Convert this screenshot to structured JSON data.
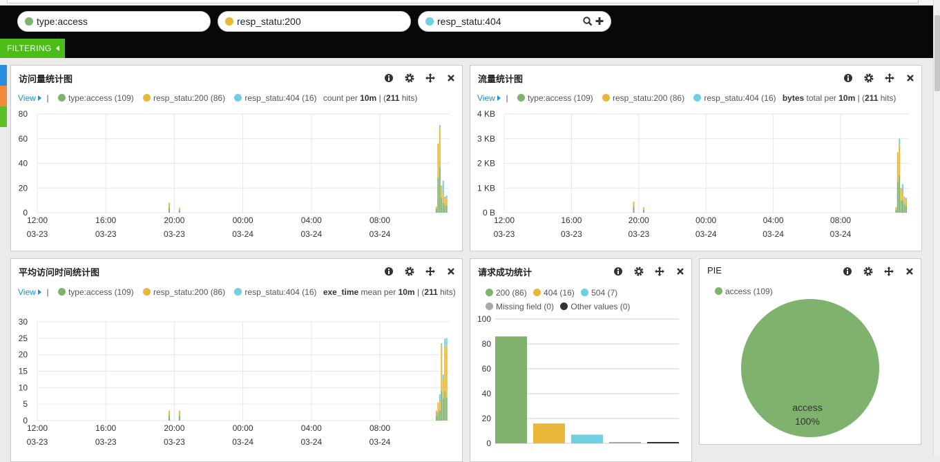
{
  "queries": [
    {
      "text": "type:access",
      "color": "#7eb26d"
    },
    {
      "text": "resp_statu:200",
      "color": "#eab839"
    },
    {
      "text": "resp_statu:404",
      "color": "#6ed0e0"
    }
  ],
  "filtering_label": "FILTERING",
  "colors": {
    "access": "#7eb26d",
    "s200": "#eab839",
    "s404": "#6ed0e0",
    "missing": "#aaaaaa",
    "other": "#333333"
  },
  "panels": {
    "visits": {
      "title": "访问量统计图",
      "legend": {
        "view": "View",
        "items": [
          "type:access (109)",
          "resp_statu:200 (86)",
          "resp_statu:404 (16)"
        ],
        "suffix_pre": "count per ",
        "interval": "10m",
        "suffix_mid": " | (",
        "hits": "211",
        "suffix_post": " hits)"
      }
    },
    "traffic": {
      "title": "流量统计图",
      "legend": {
        "view": "View",
        "items": [
          "type:access (109)",
          "resp_statu:200 (86)",
          "resp_statu:404 (16)"
        ],
        "field": "bytes",
        "suffix_pre": " total per ",
        "interval": "10m",
        "suffix_mid": " | (",
        "hits": "211",
        "suffix_post": " hits)"
      }
    },
    "avgtime": {
      "title": "平均访问时间统计图",
      "legend": {
        "view": "View",
        "items": [
          "type:access (109)",
          "resp_statu:200 (86)",
          "resp_statu:404 (16)"
        ],
        "field": "exe_time",
        "suffix_pre": " mean per ",
        "interval": "10m",
        "suffix_mid": " | (",
        "hits": "211",
        "suffix_post": " hits)"
      }
    },
    "success": {
      "title": "请求成功统计",
      "legend": [
        "200 (86)",
        "404 (16)",
        "504 (7)",
        "Missing field (0)",
        "Other values (0)"
      ]
    },
    "pie": {
      "title": "PIE",
      "legend": [
        "access (109)"
      ],
      "slice_label": "access",
      "slice_pct": "100%"
    }
  },
  "chart_data": [
    {
      "type": "bar",
      "title": "访问量统计图",
      "stacked": true,
      "x_tick_labels": [
        [
          "12:00",
          "03-23"
        ],
        [
          "16:00",
          "03-23"
        ],
        [
          "20:00",
          "03-23"
        ],
        [
          "00:00",
          "03-24"
        ],
        [
          "04:00",
          "03-24"
        ],
        [
          "08:00",
          "03-24"
        ]
      ],
      "y_ticks": [
        "0",
        "20",
        "40",
        "60",
        "80"
      ],
      "ylim": [
        0,
        80
      ],
      "x_hours": [
        19.7,
        20.3,
        11.3,
        11.4,
        11.5,
        11.6,
        11.7,
        11.8,
        11.9
      ],
      "series": [
        {
          "name": "type:access",
          "values": [
            4,
            2,
            3,
            28,
            37,
            12,
            8,
            6,
            6
          ]
        },
        {
          "name": "resp_statu:200",
          "values": [
            4,
            2,
            2,
            28,
            32,
            10,
            7,
            5,
            6
          ]
        },
        {
          "name": "resp_statu:404",
          "values": [
            0,
            0,
            0,
            0,
            2,
            0,
            11,
            2,
            2
          ]
        }
      ]
    },
    {
      "type": "bar",
      "title": "流量统计图",
      "stacked": true,
      "x_tick_labels": [
        [
          "12:00",
          "03-23"
        ],
        [
          "16:00",
          "03-23"
        ],
        [
          "20:00",
          "03-23"
        ],
        [
          "00:00",
          "03-24"
        ],
        [
          "04:00",
          "03-24"
        ],
        [
          "08:00",
          "03-24"
        ]
      ],
      "y_ticks": [
        "0 B",
        "1 KB",
        "2 KB",
        "3 KB",
        "4 KB"
      ],
      "ylim": [
        0,
        4
      ],
      "x_hours": [
        19.7,
        20.3,
        11.3,
        11.4,
        11.5,
        11.6,
        11.7,
        11.8,
        11.9
      ],
      "series": [
        {
          "name": "type:access",
          "values": [
            0.25,
            0.12,
            0.12,
            1.25,
            1.5,
            0.5,
            0.5,
            0.35,
            0.3
          ]
        },
        {
          "name": "resp_statu:200",
          "values": [
            0.2,
            0.1,
            0.1,
            1.2,
            1.25,
            0.5,
            0.35,
            0.25,
            0.2
          ]
        },
        {
          "name": "resp_statu:404",
          "values": [
            0,
            0,
            0,
            0,
            0.25,
            0,
            0.3,
            0.05,
            0.1
          ]
        }
      ]
    },
    {
      "type": "bar",
      "title": "平均访问时间统计图",
      "stacked": true,
      "x_tick_labels": [
        [
          "12:00",
          "03-23"
        ],
        [
          "16:00",
          "03-23"
        ],
        [
          "20:00",
          "03-23"
        ],
        [
          "00:00",
          "03-24"
        ],
        [
          "04:00",
          "03-24"
        ],
        [
          "08:00",
          "03-24"
        ]
      ],
      "y_ticks": [
        "0",
        "5",
        "10",
        "15",
        "20",
        "25",
        "30"
      ],
      "ylim": [
        0,
        30
      ],
      "x_hours": [
        19.7,
        20.3,
        11.3,
        11.4,
        11.5,
        11.6,
        11.7,
        11.8,
        11.9
      ],
      "series": [
        {
          "name": "type:access",
          "values": [
            1.5,
            1.5,
            1.5,
            2.5,
            3,
            9,
            6.5,
            9,
            7
          ]
        },
        {
          "name": "resp_statu:200",
          "values": [
            1.5,
            1.5,
            1.5,
            3,
            3,
            14,
            6,
            13,
            16
          ]
        },
        {
          "name": "resp_statu:404",
          "values": [
            0,
            0,
            0,
            0,
            2,
            0.5,
            1.5,
            2.8,
            2
          ]
        }
      ]
    },
    {
      "type": "bar",
      "title": "请求成功统计",
      "categories": [
        "200",
        "404",
        "504",
        "Missing field",
        "Other values"
      ],
      "values": [
        86,
        16,
        7,
        0,
        0
      ],
      "y_ticks": [
        "0",
        "20",
        "40",
        "60",
        "80",
        "100"
      ],
      "ylim": [
        0,
        100
      ]
    },
    {
      "type": "pie",
      "title": "PIE",
      "categories": [
        "access"
      ],
      "values": [
        109
      ]
    }
  ]
}
